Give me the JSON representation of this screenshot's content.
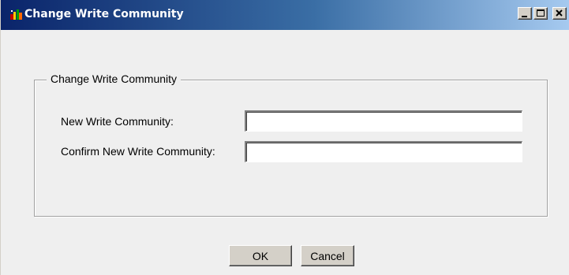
{
  "window": {
    "title": "Change Write Community",
    "icon": "app-icon",
    "controls": {
      "minimize": "minimize-icon",
      "maximize": "maximize-icon",
      "close": "close-icon"
    }
  },
  "group": {
    "legend": "Change Write Community",
    "fields": {
      "new_label": "New Write Community:",
      "new_value": "",
      "confirm_label": "Confirm New Write Community:",
      "confirm_value": ""
    }
  },
  "buttons": {
    "ok_label": "OK",
    "cancel_label": "Cancel"
  },
  "colors": {
    "titlebar_start": "#0a246a",
    "titlebar_end": "#a6caf0",
    "dialog_bg": "#efefef",
    "button_face": "#d4d0c8"
  }
}
